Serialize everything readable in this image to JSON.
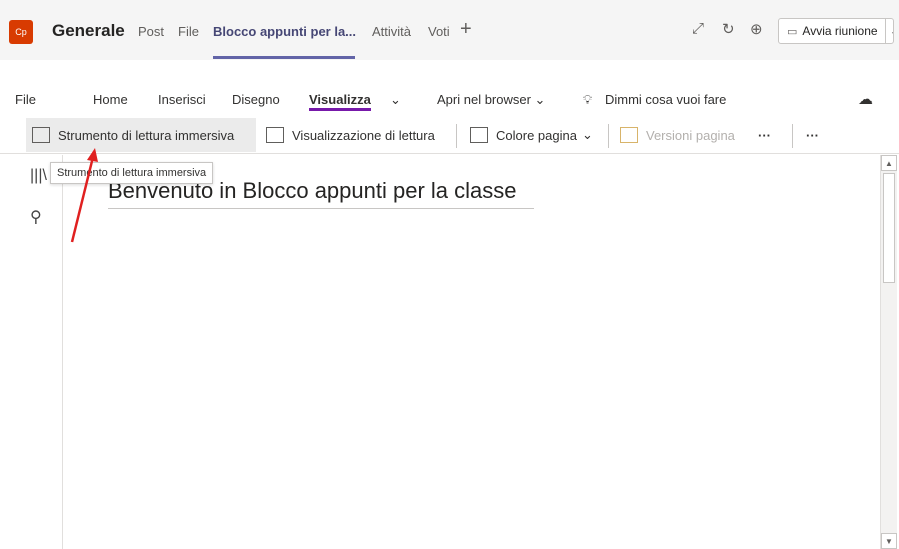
{
  "header": {
    "avatar_text": "Cp",
    "channel_name": "Generale",
    "tabs": [
      {
        "label": "Post"
      },
      {
        "label": "File"
      },
      {
        "label": "Blocco appunti per la..."
      },
      {
        "label": "Attività"
      },
      {
        "label": "Voti"
      }
    ],
    "add_tab_icon": "+",
    "meet_button_label": "Avvia riunione"
  },
  "ribbon": {
    "tabs": [
      {
        "label": "File"
      },
      {
        "label": "Home"
      },
      {
        "label": "Inserisci"
      },
      {
        "label": "Disegno"
      },
      {
        "label": "Visualizza"
      },
      {
        "label": "Apri nel browser"
      },
      {
        "label": "Dimmi cosa vuoi fare"
      }
    ],
    "commands": [
      {
        "label": "Strumento di lettura immersiva"
      },
      {
        "label": "Visualizzazione di lettura"
      },
      {
        "label": "Colore pagina"
      },
      {
        "label": "Versioni pagina"
      }
    ],
    "more": "···"
  },
  "tooltip": "Strumento di lettura immersiva",
  "page": {
    "title": "Benvenuto in Blocco appunti per la classe"
  },
  "colors": {
    "accent": "#6264a7",
    "onenote_purple": "#7719aa",
    "team_avatar": "#d83b01",
    "annotation_arrow": "#e02020"
  }
}
